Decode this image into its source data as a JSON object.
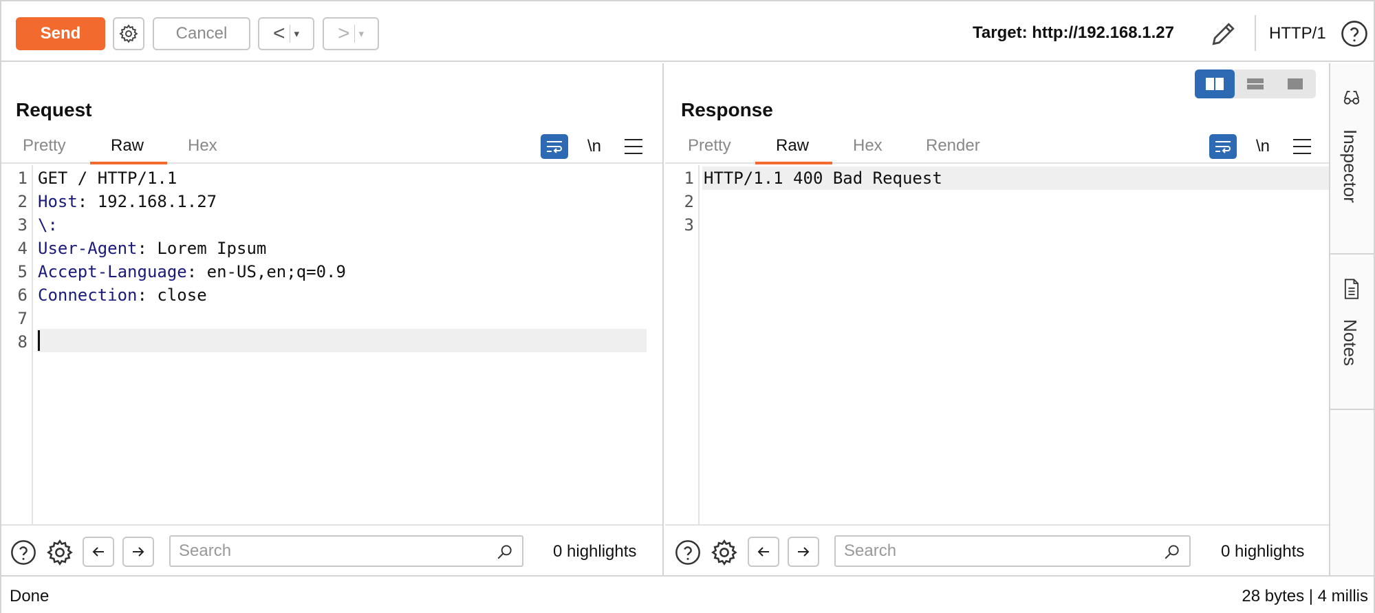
{
  "toolbar": {
    "send_label": "Send",
    "cancel_label": "Cancel",
    "back_glyph": "<",
    "forward_glyph": ">",
    "dropdown_glyph": "▾",
    "target_label": "Target: http://192.168.1.27",
    "http_version": "HTTP/1"
  },
  "request": {
    "title": "Request",
    "tabs": [
      {
        "label": "Pretty",
        "active": false
      },
      {
        "label": "Raw",
        "active": true
      },
      {
        "label": "Hex",
        "active": false
      }
    ],
    "newline_label": "\\n",
    "lines": [
      {
        "num": "1",
        "key": "",
        "rest": "GET / HTTP/1.1"
      },
      {
        "num": "2",
        "key": "Host",
        "rest": ": 192.168.1.27"
      },
      {
        "num": "3",
        "key": "\\:",
        "rest": ""
      },
      {
        "num": "4",
        "key": "User-Agent",
        "rest": ": Lorem Ipsum"
      },
      {
        "num": "5",
        "key": "Accept-Language",
        "rest": ": en-US,en;q=0.9"
      },
      {
        "num": "6",
        "key": "Connection",
        "rest": ": close"
      },
      {
        "num": "7",
        "key": "",
        "rest": ""
      },
      {
        "num": "8",
        "key": "",
        "rest": ""
      }
    ],
    "search_placeholder": "Search",
    "highlights": "0 highlights"
  },
  "response": {
    "title": "Response",
    "tabs": [
      {
        "label": "Pretty",
        "active": false
      },
      {
        "label": "Raw",
        "active": true
      },
      {
        "label": "Hex",
        "active": false
      },
      {
        "label": "Render",
        "active": false
      }
    ],
    "newline_label": "\\n",
    "lines": [
      {
        "num": "1",
        "key": "",
        "rest": "HTTP/1.1 400 Bad Request"
      },
      {
        "num": "2",
        "key": "",
        "rest": ""
      },
      {
        "num": "3",
        "key": "",
        "rest": ""
      }
    ],
    "search_placeholder": "Search",
    "highlights": "0 highlights"
  },
  "sidebar": {
    "inspector_label": "Inspector",
    "notes_label": "Notes"
  },
  "status": {
    "left": "Done",
    "right": "28 bytes | 4 millis"
  },
  "colors": {
    "accent": "#f26a2e",
    "blue": "#2d6ab3",
    "header_key": "#1a1a7c"
  }
}
